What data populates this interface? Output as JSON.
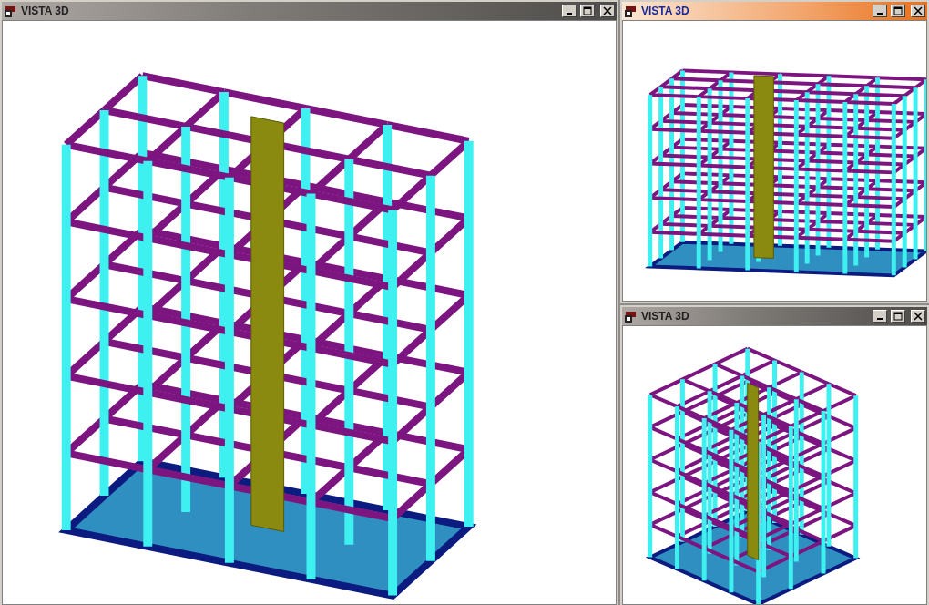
{
  "windows": [
    {
      "title": "VISTA 3D",
      "active": false
    },
    {
      "title": "VISTA 3D",
      "active": true
    },
    {
      "title": "VISTA 3D",
      "active": false
    }
  ]
}
